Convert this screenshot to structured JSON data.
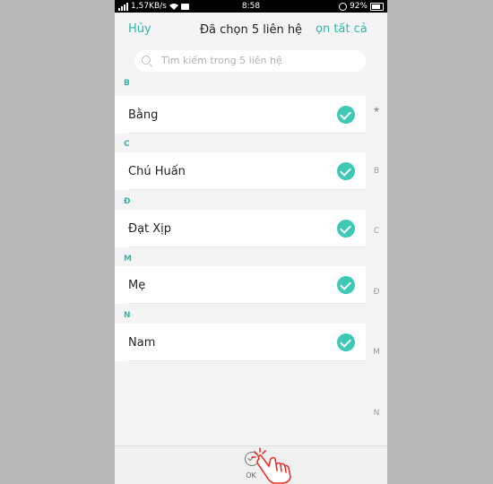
{
  "status_bar": {
    "speed": "1,57KB/s",
    "time": "8:58",
    "battery": "92%"
  },
  "header": {
    "cancel_label": "Hủy",
    "title": "Đã chọn 5 liên hệ",
    "select_all_label": "ọn tất cả"
  },
  "search": {
    "placeholder": "Tìm kiếm trong 5 liên hệ"
  },
  "sections": [
    {
      "letter": "B",
      "contacts": [
        {
          "name": "Bằng",
          "checked": true
        }
      ]
    },
    {
      "letter": "C",
      "contacts": [
        {
          "name": "Chú Huấn",
          "checked": true
        }
      ]
    },
    {
      "letter": "Đ",
      "contacts": [
        {
          "name": "Đạt Xịp",
          "checked": true
        }
      ]
    },
    {
      "letter": "M",
      "contacts": [
        {
          "name": "Mẹ",
          "checked": true
        }
      ]
    },
    {
      "letter": "N",
      "contacts": [
        {
          "name": "Nam",
          "checked": true
        }
      ]
    }
  ],
  "index_bar": [
    "★",
    "B",
    "C",
    "Đ",
    "M",
    "N"
  ],
  "bottom": {
    "ok_label": "OK"
  },
  "colors": {
    "accent": "#2fb6a8",
    "check": "#3dc9b6",
    "tap_indicator": "#e8332b"
  }
}
